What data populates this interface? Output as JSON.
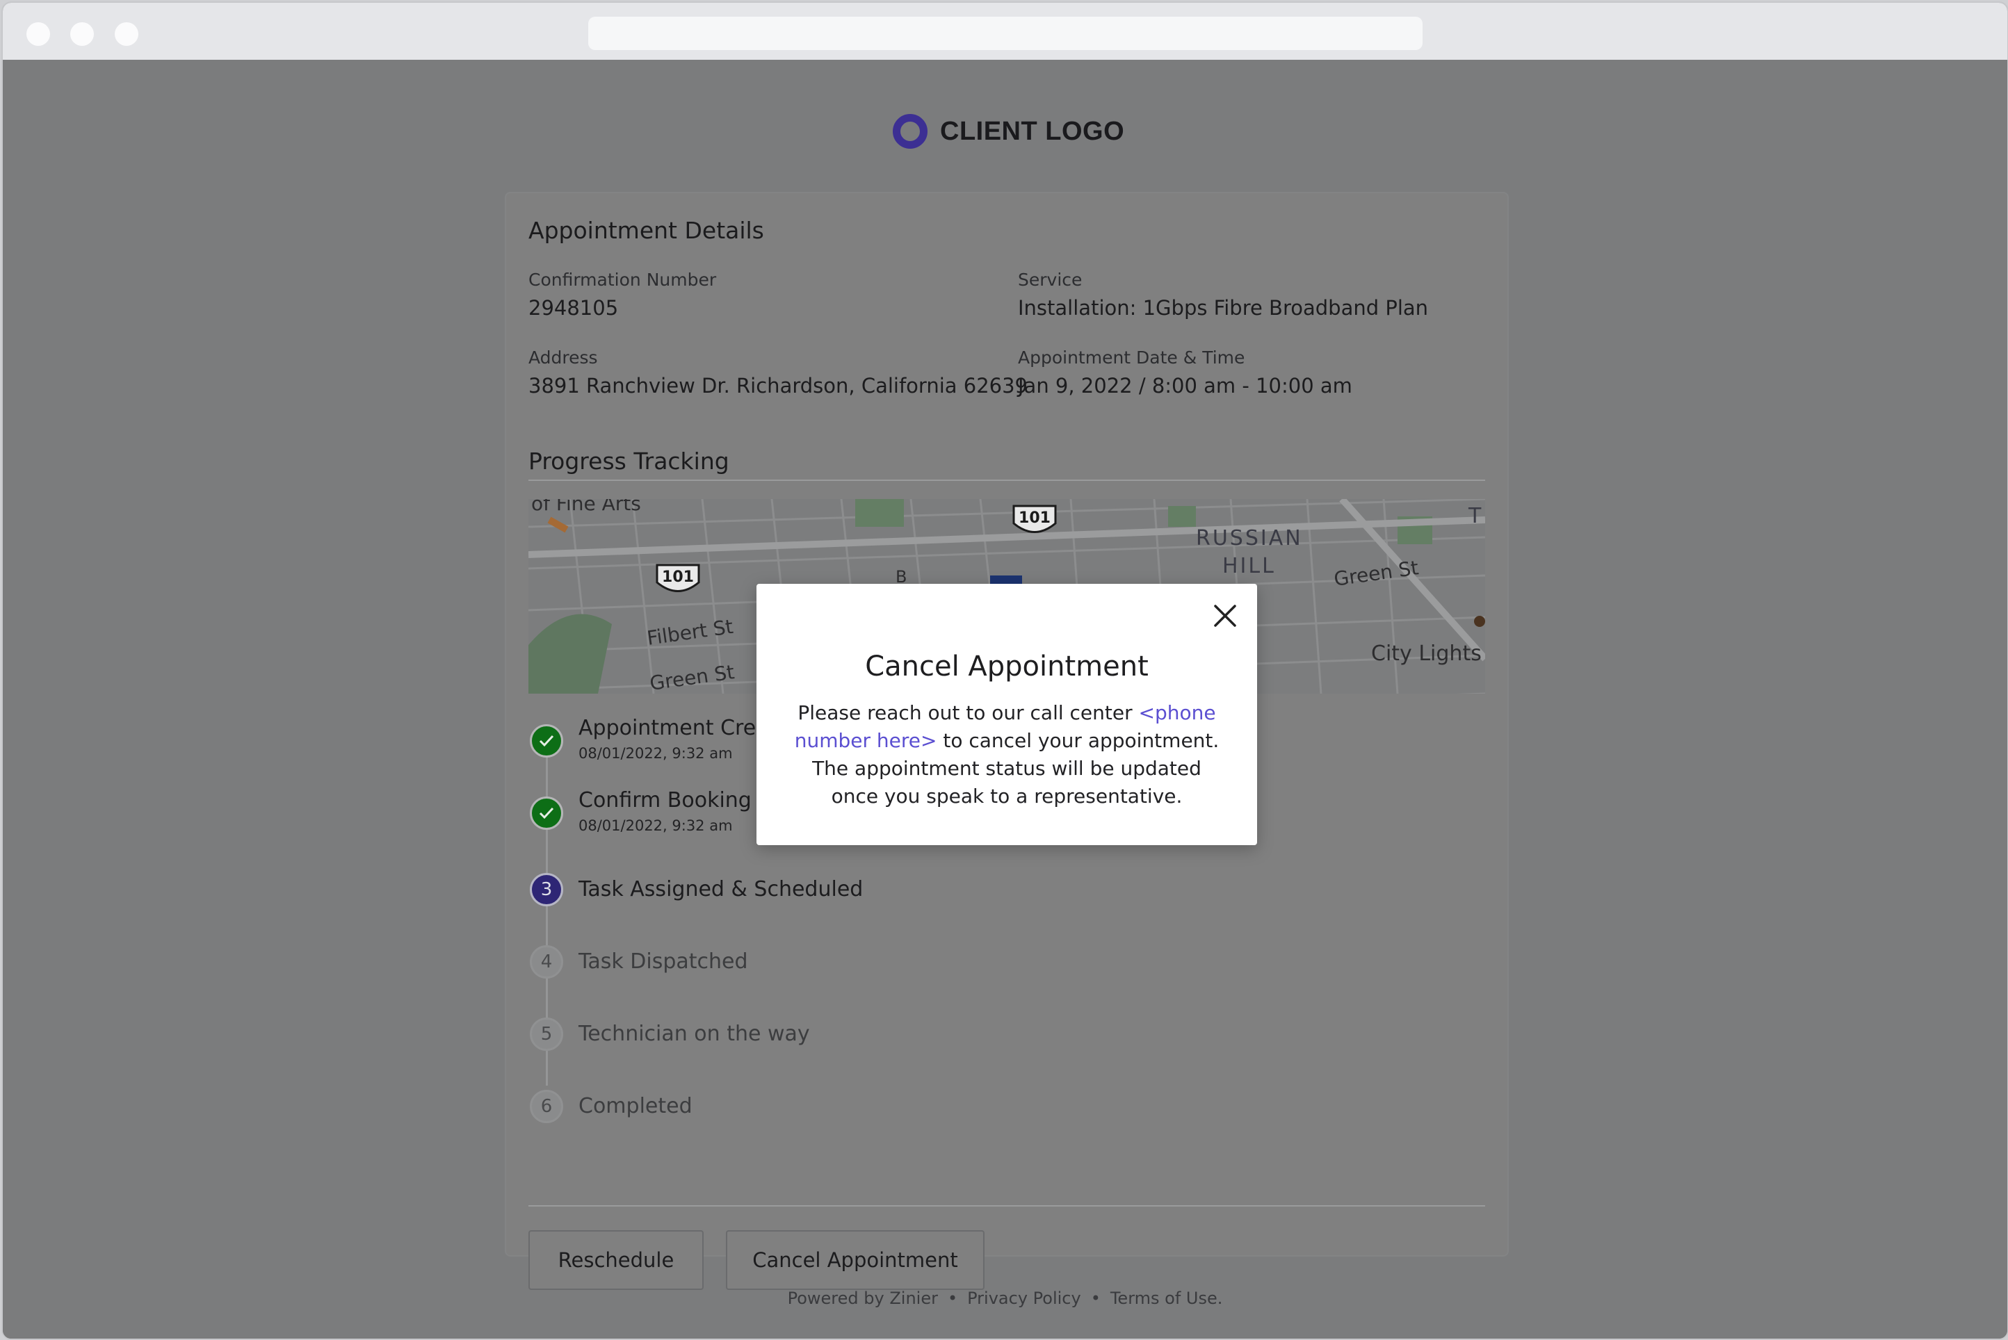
{
  "brand": {
    "logo_text": "CLIENT LOGO",
    "accent": "#3c2f93"
  },
  "details": {
    "title": "Appointment Details",
    "confirmation_label": "Confirmation Number",
    "confirmation_value": "2948105",
    "service_label": "Service",
    "service_value": "Installation: 1Gbps Fibre Broadband Plan",
    "address_label": "Address",
    "address_value": "3891 Ranchview Dr. Richardson, California 62639",
    "datetime_label": "Appointment Date & Time",
    "datetime_value": "Jan 9, 2022 / 8:00 am - 10:00 am"
  },
  "progress": {
    "title": "Progress Tracking",
    "map_labels": {
      "fine_arts": "of Fine Arts",
      "hwy_a": "101",
      "hwy_b": "101",
      "russian": "RUSSIAN",
      "hill": "HILL",
      "green_st_right": "Green St",
      "filbert": "Filbert St",
      "green_st_left": "Green St",
      "city_lights": "City Lights B",
      "t_letter": "T",
      "b_letter": "B"
    },
    "steps": [
      {
        "number": "1",
        "title": "Appointment Created",
        "time": "08/01/2022, 9:32 am",
        "state": "done"
      },
      {
        "number": "2",
        "title": "Confirm Booking",
        "time": "08/01/2022, 9:32 am",
        "state": "done"
      },
      {
        "number": "3",
        "title": "Task Assigned & Scheduled",
        "time": "",
        "state": "current"
      },
      {
        "number": "4",
        "title": "Task Dispatched",
        "time": "",
        "state": "pending"
      },
      {
        "number": "5",
        "title": "Technician on the way",
        "time": "",
        "state": "pending"
      },
      {
        "number": "6",
        "title": "Completed",
        "time": "",
        "state": "pending"
      }
    ]
  },
  "actions": {
    "reschedule": "Reschedule",
    "cancel": "Cancel Appointment"
  },
  "footer": {
    "powered": "Powered by Zinier",
    "sep": "•",
    "privacy": "Privacy Policy",
    "terms": "Terms of Use."
  },
  "modal": {
    "title": "Cancel Appointment",
    "text_before": "Please reach out to our call center ",
    "link": "<phone number here>",
    "text_after": " to cancel your appointment. The  appointment status will be updated once you speak to a representative."
  },
  "colors": {
    "done": "#0d6e16",
    "current": "#2e2675",
    "link": "#5b4fd1"
  }
}
